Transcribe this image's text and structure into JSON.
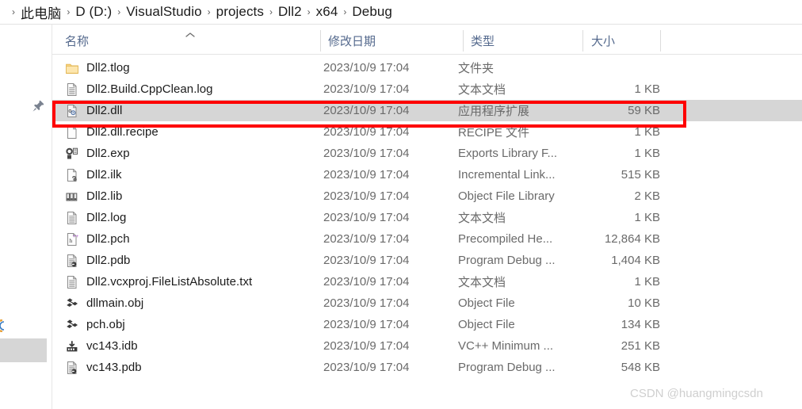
{
  "breadcrumb": {
    "separator": "›",
    "items": [
      {
        "label": "此电脑"
      },
      {
        "label": "D (D:)"
      },
      {
        "label": "VisualStudio"
      },
      {
        "label": "projects"
      },
      {
        "label": "Dll2"
      },
      {
        "label": "x64"
      },
      {
        "label": "Debug"
      }
    ]
  },
  "nav_pane": {
    "pin_icon": "pushpin-icon",
    "selected_item_label": ""
  },
  "columns": {
    "name": "名称",
    "date_modified": "修改日期",
    "type": "类型",
    "size": "大小",
    "sort_indicator": "sort-ascending-chevron"
  },
  "files": [
    {
      "name": "Dll2.tlog",
      "date": "2023/10/9 17:04",
      "type": "文件夹",
      "size": "",
      "icon": "folder-icon",
      "selected": false
    },
    {
      "name": "Dll2.Build.CppClean.log",
      "date": "2023/10/9 17:04",
      "type": "文本文档",
      "size": "1 KB",
      "icon": "text-document-icon",
      "selected": false
    },
    {
      "name": "Dll2.dll",
      "date": "2023/10/9 17:04",
      "type": "应用程序扩展",
      "size": "59 KB",
      "icon": "dll-icon",
      "selected": true
    },
    {
      "name": "Dll2.dll.recipe",
      "date": "2023/10/9 17:04",
      "type": "RECIPE 文件",
      "size": "1 KB",
      "icon": "blank-page-icon",
      "selected": false
    },
    {
      "name": "Dll2.exp",
      "date": "2023/10/9 17:04",
      "type": "Exports Library F...",
      "size": "1 KB",
      "icon": "exports-library-icon",
      "selected": false
    },
    {
      "name": "Dll2.ilk",
      "date": "2023/10/9 17:04",
      "type": "Incremental Link...",
      "size": "515 KB",
      "icon": "incremental-link-icon",
      "selected": false
    },
    {
      "name": "Dll2.lib",
      "date": "2023/10/9 17:04",
      "type": "Object File Library",
      "size": "2 KB",
      "icon": "object-library-icon",
      "selected": false
    },
    {
      "name": "Dll2.log",
      "date": "2023/10/9 17:04",
      "type": "文本文档",
      "size": "1 KB",
      "icon": "text-document-icon",
      "selected": false
    },
    {
      "name": "Dll2.pch",
      "date": "2023/10/9 17:04",
      "type": "Precompiled He...",
      "size": "12,864 KB",
      "icon": "precompiled-header-icon",
      "selected": false
    },
    {
      "name": "Dll2.pdb",
      "date": "2023/10/9 17:04",
      "type": "Program Debug ...",
      "size": "1,404 KB",
      "icon": "program-debug-icon",
      "selected": false
    },
    {
      "name": "Dll2.vcxproj.FileListAbsolute.txt",
      "date": "2023/10/9 17:04",
      "type": "文本文档",
      "size": "1 KB",
      "icon": "text-document-icon",
      "selected": false
    },
    {
      "name": "dllmain.obj",
      "date": "2023/10/9 17:04",
      "type": "Object File",
      "size": "10 KB",
      "icon": "object-file-icon",
      "selected": false
    },
    {
      "name": "pch.obj",
      "date": "2023/10/9 17:04",
      "type": "Object File",
      "size": "134 KB",
      "icon": "object-file-icon",
      "selected": false
    },
    {
      "name": "vc143.idb",
      "date": "2023/10/9 17:04",
      "type": "VC++ Minimum ...",
      "size": "251 KB",
      "icon": "idb-icon",
      "selected": false
    },
    {
      "name": "vc143.pdb",
      "date": "2023/10/9 17:04",
      "type": "Program Debug ...",
      "size": "548 KB",
      "icon": "program-debug-icon",
      "selected": false
    }
  ],
  "annotation": {
    "target_row_name": "Dll2.dll",
    "color": "#fe0000"
  },
  "watermark": {
    "text": "CSDN @huangmingcsdn"
  }
}
